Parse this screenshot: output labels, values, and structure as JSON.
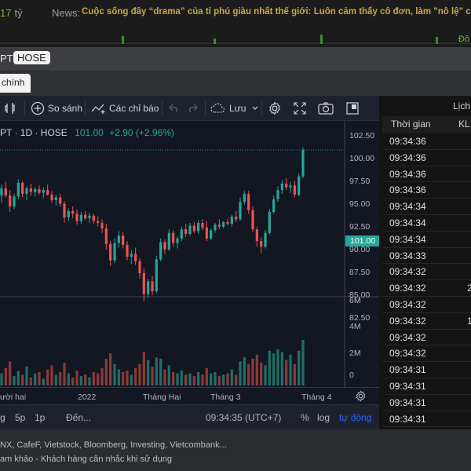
{
  "topbar": {
    "amount": "17",
    "amount_unit": "tỷ",
    "news_label": "News:",
    "news_text": "Cuộc sống đầy “drama” của tỉ phú giàu nhất thế giới: Luôn cảm thấy cô đơn, làm \"nô lệ\" cho cô",
    "right_label": "Đồ"
  },
  "panel": {
    "symbol": "PT",
    "exchange": "HOSE",
    "tab_active": "chính"
  },
  "toolbar": {
    "compare_label": "So sánh",
    "indicators_label": "Các chỉ báo",
    "save_label": "Lưu"
  },
  "legend": {
    "symbol_text": "PT · 1D · HOSE",
    "price": "101.00",
    "change": "+2.90 (+2.96%)"
  },
  "price_axis": {
    "labels": [
      "102.50",
      "100.00",
      "97.50",
      "95.00",
      "92.50",
      "90.00",
      "87.50",
      "85.00",
      "82.50"
    ],
    "current": "101.00"
  },
  "volume_axis": {
    "labels": [
      "6M",
      "4M",
      "2M",
      "0"
    ]
  },
  "time_axis": {
    "labels": [
      "ười hai",
      "2022",
      "Tháng Hai",
      "Tháng 3",
      "Tháng 4"
    ]
  },
  "bottom_bar": {
    "range_items": [
      "g",
      "5p",
      "1p"
    ],
    "goto_label": "Đến...",
    "clock": "09:34:35 (UTC+7)",
    "percent": "%",
    "log": "log",
    "auto": "tự động"
  },
  "trade_panel": {
    "title": "Lịch",
    "col_time": "Thời gian",
    "col_kl": "KL",
    "rows": [
      {
        "time": "09:34:36",
        "kl": ""
      },
      {
        "time": "09:34:36",
        "kl": ""
      },
      {
        "time": "09:34:36",
        "kl": ""
      },
      {
        "time": "09:34:36",
        "kl": ""
      },
      {
        "time": "09:34:34",
        "kl": ""
      },
      {
        "time": "09:34:34",
        "kl": ""
      },
      {
        "time": "09:34:34",
        "kl": ""
      },
      {
        "time": "09:34:33",
        "kl": ""
      },
      {
        "time": "09:34:32",
        "kl": ""
      },
      {
        "time": "09:34:32",
        "kl": "2"
      },
      {
        "time": "09:34:32",
        "kl": ""
      },
      {
        "time": "09:34:32",
        "kl": "1"
      },
      {
        "time": "09:34:32",
        "kl": ""
      },
      {
        "time": "09:34:32",
        "kl": ""
      },
      {
        "time": "09:34:31",
        "kl": ""
      },
      {
        "time": "09:34:31",
        "kl": ""
      },
      {
        "time": "09:34:31",
        "kl": ""
      },
      {
        "time": "09:34:31",
        "kl": ""
      }
    ]
  },
  "footer": {
    "line1": "NX, CafeF, Vietstock, Bloomberg, Investing, Vietcombank...",
    "line2": "am khảo - Khách hàng cân nhắc khi sử dụng"
  },
  "colors": {
    "up": "#26a69a",
    "down": "#ef5350",
    "accent": "#2962ff",
    "news": "#c8a64a"
  },
  "chart_data": {
    "type": "candlestick",
    "price_range": [
      82.5,
      103.5
    ],
    "volume_range": [
      0,
      6000000
    ],
    "candles": [
      [
        96.0,
        97.2,
        95.2,
        96.8
      ],
      [
        96.8,
        97.5,
        95.8,
        96.0
      ],
      [
        96.0,
        96.6,
        94.2,
        94.8
      ],
      [
        94.8,
        96.2,
        94.5,
        95.9
      ],
      [
        95.9,
        97.8,
        95.6,
        97.4
      ],
      [
        97.4,
        97.6,
        95.8,
        96.2
      ],
      [
        96.2,
        97.0,
        95.5,
        96.8
      ],
      [
        96.8,
        97.3,
        96.0,
        96.4
      ],
      [
        96.4,
        96.9,
        95.9,
        96.7
      ],
      [
        96.7,
        97.1,
        96.1,
        96.3
      ],
      [
        96.3,
        96.9,
        95.7,
        96.6
      ],
      [
        96.6,
        97.2,
        96.0,
        96.1
      ],
      [
        96.1,
        96.5,
        95.2,
        95.5
      ],
      [
        95.5,
        96.1,
        94.9,
        95.8
      ],
      [
        95.8,
        96.2,
        94.8,
        95.1
      ],
      [
        95.1,
        95.4,
        93.0,
        93.6
      ],
      [
        93.6,
        94.6,
        93.2,
        94.3
      ],
      [
        94.3,
        94.8,
        93.5,
        94.0
      ],
      [
        94.0,
        94.5,
        92.8,
        93.2
      ],
      [
        93.2,
        94.2,
        92.9,
        93.9
      ],
      [
        93.9,
        94.3,
        93.3,
        93.5
      ],
      [
        93.5,
        94.1,
        93.0,
        93.8
      ],
      [
        93.8,
        94.0,
        92.9,
        93.2
      ],
      [
        93.2,
        93.7,
        92.6,
        93.0
      ],
      [
        93.0,
        93.4,
        91.9,
        92.4
      ],
      [
        92.4,
        92.9,
        90.1,
        90.7
      ],
      [
        90.7,
        91.0,
        88.3,
        88.9
      ],
      [
        88.9,
        91.3,
        88.6,
        90.8
      ],
      [
        90.8,
        92.1,
        90.3,
        91.6
      ],
      [
        91.6,
        92.0,
        90.2,
        90.6
      ],
      [
        90.6,
        91.0,
        88.9,
        89.3
      ],
      [
        89.3,
        90.0,
        88.5,
        89.6
      ],
      [
        89.6,
        90.3,
        88.4,
        88.8
      ],
      [
        88.8,
        89.1,
        86.9,
        87.5
      ],
      [
        87.5,
        88.0,
        84.4,
        85.2
      ],
      [
        85.2,
        86.9,
        84.8,
        86.6
      ],
      [
        86.6,
        87.2,
        85.1,
        85.5
      ],
      [
        85.5,
        89.4,
        85.3,
        89.0
      ],
      [
        89.0,
        91.3,
        88.8,
        90.9
      ],
      [
        90.9,
        91.2,
        89.6,
        90.1
      ],
      [
        90.1,
        92.3,
        89.9,
        91.9
      ],
      [
        91.9,
        92.2,
        90.4,
        90.8
      ],
      [
        90.8,
        91.5,
        90.2,
        91.3
      ],
      [
        91.3,
        92.6,
        91.0,
        92.3
      ],
      [
        92.3,
        92.9,
        91.5,
        91.8
      ],
      [
        91.8,
        93.0,
        91.6,
        92.7
      ],
      [
        92.7,
        93.1,
        91.9,
        92.1
      ],
      [
        92.1,
        93.3,
        91.8,
        93.0
      ],
      [
        93.0,
        93.4,
        92.2,
        92.5
      ],
      [
        92.5,
        93.2,
        91.0,
        91.3
      ],
      [
        91.3,
        92.4,
        91.1,
        92.2
      ],
      [
        92.2,
        93.0,
        91.9,
        92.8
      ],
      [
        92.8,
        93.4,
        92.3,
        92.6
      ],
      [
        92.6,
        93.2,
        92.4,
        93.1
      ],
      [
        93.1,
        93.5,
        92.7,
        92.9
      ],
      [
        92.9,
        93.9,
        92.6,
        93.7
      ],
      [
        93.7,
        94.3,
        93.1,
        93.4
      ],
      [
        93.4,
        95.8,
        93.2,
        95.3
      ],
      [
        95.3,
        96.5,
        95.0,
        96.2
      ],
      [
        96.2,
        96.5,
        94.0,
        94.4
      ],
      [
        94.4,
        94.8,
        92.0,
        92.3
      ],
      [
        92.3,
        92.6,
        90.4,
        91.0
      ],
      [
        91.0,
        91.4,
        89.7,
        90.4
      ],
      [
        90.4,
        92.2,
        90.2,
        91.9
      ],
      [
        91.9,
        94.5,
        91.7,
        94.2
      ],
      [
        94.2,
        96.0,
        94.0,
        95.6
      ],
      [
        95.6,
        97.0,
        95.3,
        96.6
      ],
      [
        96.6,
        97.7,
        96.2,
        97.3
      ],
      [
        97.3,
        97.9,
        96.6,
        96.9
      ],
      [
        96.9,
        97.5,
        96.3,
        97.1
      ],
      [
        97.1,
        97.6,
        95.8,
        96.1
      ],
      [
        96.1,
        98.4,
        95.9,
        98.1
      ],
      [
        98.1,
        101.3,
        97.9,
        101.0
      ]
    ],
    "volumes_m": [
      0.9,
      1.3,
      1.8,
      0.7,
      1.1,
      0.8,
      1.4,
      0.6,
      0.9,
      1.0,
      0.5,
      1.2,
      1.5,
      0.8,
      1.0,
      1.7,
      0.9,
      0.6,
      1.1,
      0.7,
      0.8,
      0.6,
      1.0,
      0.9,
      1.3,
      2.0,
      2.4,
      1.6,
      1.2,
      1.0,
      1.1,
      0.8,
      1.3,
      1.6,
      2.5,
      1.9,
      1.4,
      2.1,
      2.0,
      1.2,
      1.5,
      1.0,
      0.9,
      1.1,
      0.8,
      0.9,
      0.7,
      1.0,
      0.8,
      1.3,
      0.9,
      1.0,
      0.7,
      0.8,
      0.9,
      1.2,
      0.8,
      1.8,
      2.1,
      1.6,
      2.0,
      2.3,
      1.7,
      1.5,
      2.6,
      2.4,
      2.7,
      2.5,
      1.9,
      2.3,
      1.6,
      2.6,
      3.4
    ]
  }
}
